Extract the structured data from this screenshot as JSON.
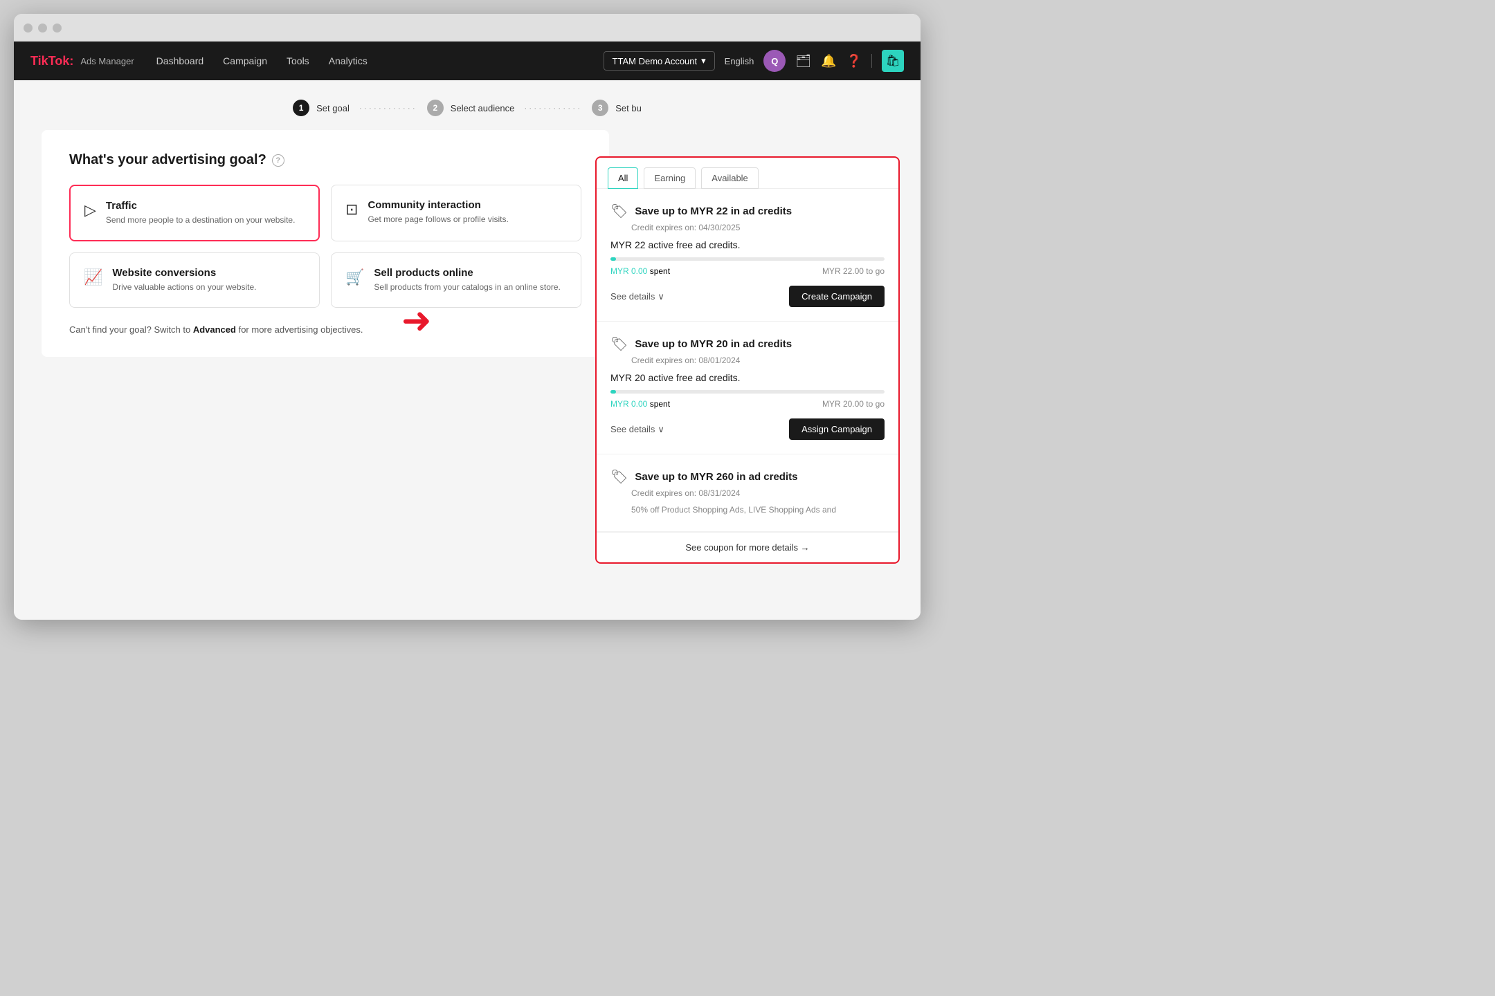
{
  "window": {
    "title": "TikTok Ads Manager"
  },
  "topnav": {
    "logo": "TikTok:",
    "logo_sub": "Ads Manager",
    "nav_links": [
      {
        "label": "Dashboard",
        "id": "dashboard"
      },
      {
        "label": "Campaign",
        "id": "campaign"
      },
      {
        "label": "Tools",
        "id": "tools"
      },
      {
        "label": "Analytics",
        "id": "analytics"
      }
    ],
    "account_btn": "TTAM Demo Account",
    "lang": "English",
    "avatar": "Q"
  },
  "steps": [
    {
      "num": "1",
      "label": "Set goal",
      "active": true
    },
    {
      "num": "2",
      "label": "Select audience",
      "active": false
    },
    {
      "num": "3",
      "label": "Set bu",
      "active": false
    }
  ],
  "goal_section": {
    "title": "What's your advertising goal?",
    "cards": [
      {
        "id": "traffic",
        "title": "Traffic",
        "desc": "Send more people to a destination on your website.",
        "selected": true
      },
      {
        "id": "community",
        "title": "Community interaction",
        "desc": "Get more page follows or profile visits.",
        "selected": false
      },
      {
        "id": "conversions",
        "title": "Website conversions",
        "desc": "Drive valuable actions on your website.",
        "selected": false
      },
      {
        "id": "sell",
        "title": "Sell products online",
        "desc": "Sell products from your catalogs in an online store.",
        "selected": false
      }
    ],
    "advanced_text": "Can't find your goal? Switch to",
    "advanced_link": "Advanced",
    "advanced_suffix": "for more advertising objectives."
  },
  "coupon_panel": {
    "tabs": [
      {
        "id": "all",
        "label": "All",
        "active": true
      },
      {
        "id": "earning",
        "label": "Earning"
      },
      {
        "id": "available",
        "label": "Available"
      }
    ],
    "coupons": [
      {
        "id": "coupon1",
        "title": "Save up to MYR 22 in ad credits",
        "expiry": "Credit expires on: 04/30/2025",
        "active_text": "MYR 22 active free ad credits.",
        "spent": "MYR 0.00",
        "spent_label": "spent",
        "togo": "MYR 22.00 to go",
        "progress": 2,
        "btn_label": "Create Campaign",
        "see_details": "See details"
      },
      {
        "id": "coupon2",
        "title": "Save up to MYR 20 in ad credits",
        "expiry": "Credit expires on: 08/01/2024",
        "active_text": "MYR 20 active free ad credits.",
        "spent": "MYR 0.00",
        "spent_label": "spent",
        "togo": "MYR 20.00 to go",
        "progress": 2,
        "btn_label": "Assign Campaign",
        "see_details": "See details"
      },
      {
        "id": "coupon3",
        "title": "Save up to MYR 260 in ad credits",
        "expiry": "Credit expires on: 08/31/2024",
        "partial_text": "50% off Product Shopping Ads, LIVE Shopping Ads and",
        "btn_label": "",
        "see_details": ""
      }
    ],
    "see_coupon_text": "See coupon for more details →"
  }
}
